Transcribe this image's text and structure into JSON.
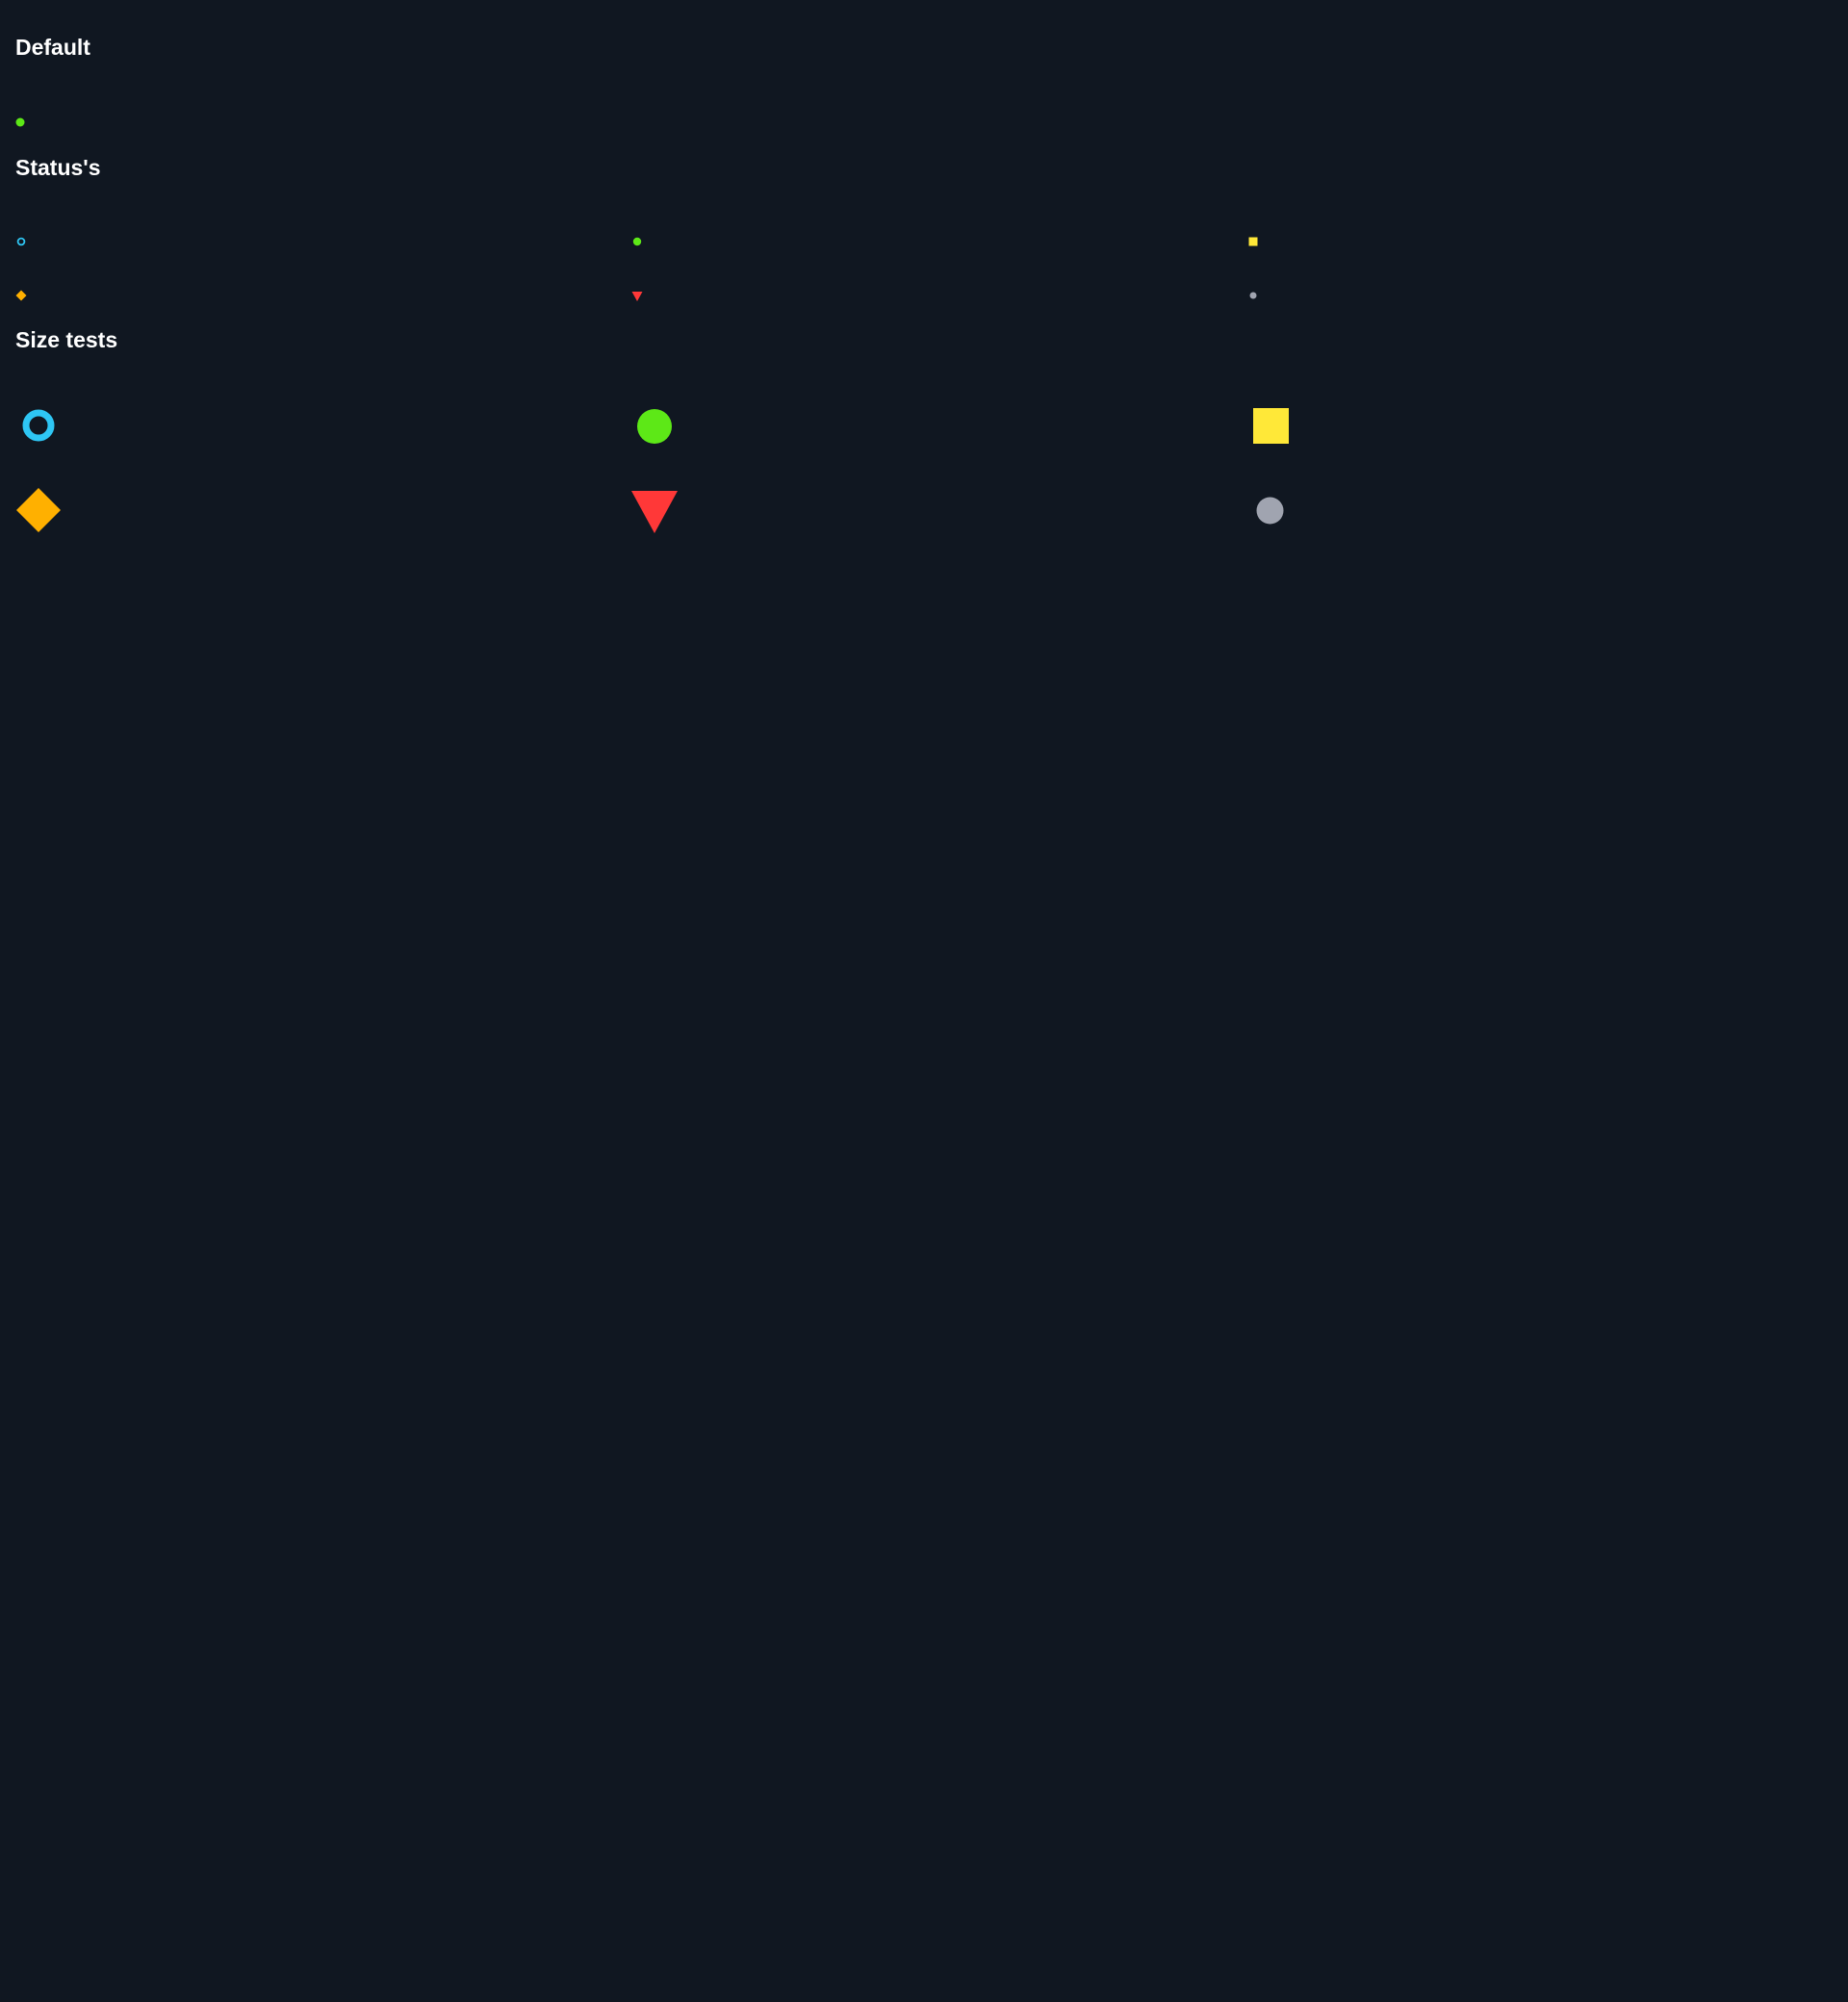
{
  "sections": {
    "default": {
      "title": "Default"
    },
    "statuses": {
      "title": "Status's"
    },
    "size_tests": {
      "title": "Size tests"
    }
  },
  "colors": {
    "background": "#101721",
    "info": "#2ec6f4",
    "success": "#5de817",
    "warning": "#ffe838",
    "caution": "#ffb000",
    "error": "#ff3838",
    "neutral": "#a0a4b0"
  },
  "icons": {
    "default": [
      "status-dot-success-icon"
    ],
    "statuses": [
      "status-ring-info-icon",
      "status-dot-success-icon",
      "status-square-warning-icon",
      "status-diamond-caution-icon",
      "status-triangle-error-icon",
      "status-dot-neutral-icon"
    ],
    "size_tests": [
      "status-ring-info-icon",
      "status-dot-success-icon",
      "status-square-warning-icon",
      "status-diamond-caution-icon",
      "status-triangle-error-icon",
      "status-dot-neutral-icon"
    ]
  }
}
